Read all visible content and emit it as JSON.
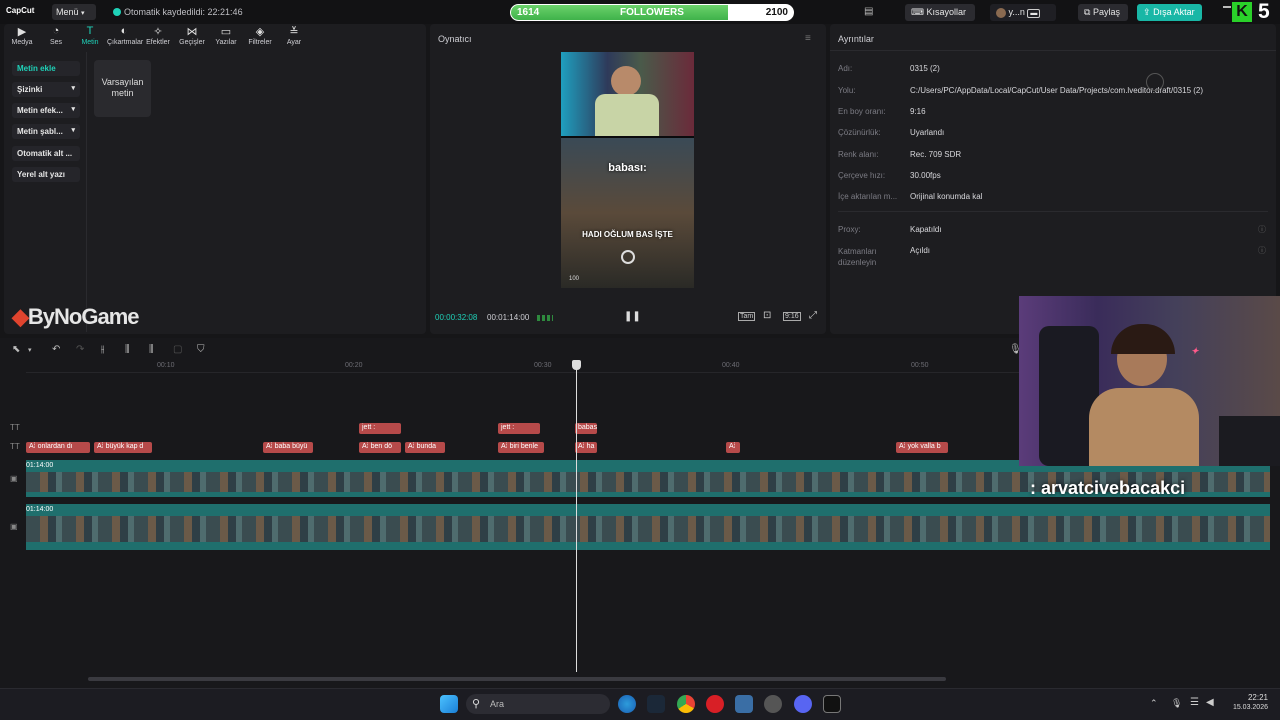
{
  "topbar": {
    "app_name": "CapCut",
    "menu_label": "Menü",
    "saved_text": "Otomatik kaydedildi: 22:21:46",
    "followers_current": "1614",
    "followers_label": "FOLLOWERS",
    "followers_goal": "2100",
    "followers_progress": 0.7686,
    "shortcuts_label": "Kısayollar",
    "user_label": "y...n",
    "share_label": "Paylaş",
    "export_label": "Dışa Aktar",
    "corner_number": "5"
  },
  "toolbar": {
    "items": [
      {
        "label": "Medya",
        "icon": "media-icon"
      },
      {
        "label": "Ses",
        "icon": "audio-icon"
      },
      {
        "label": "Metin",
        "icon": "text-icon"
      },
      {
        "label": "Çıkartmalar",
        "icon": "sticker-icon"
      },
      {
        "label": "Efektler",
        "icon": "effects-icon"
      },
      {
        "label": "Geçişler",
        "icon": "transitions-icon"
      },
      {
        "label": "Yazılar",
        "icon": "captions-icon"
      },
      {
        "label": "Filtreler",
        "icon": "filters-icon"
      },
      {
        "label": "Ayar",
        "icon": "adjust-icon"
      }
    ],
    "active": "Metin"
  },
  "sidebar": {
    "items": [
      "Metin ekle",
      "Şizinki",
      "Metin efek...",
      "Metin şabl...",
      "Otomatik alt ...",
      "Yerel alt yazı"
    ],
    "tile_label": "Varsayılan metin",
    "watermark": "ByNoGame"
  },
  "player": {
    "title": "Oynatıcı",
    "current_time": "00:00:32:08",
    "total_time": "00:01:14:00",
    "subtitle_1": "babası:",
    "subtitle_2": "HADI OĞLUM BAS İŞTE",
    "ratio_label": "9:16",
    "full_label": "Tam",
    "hud_value": "100"
  },
  "details": {
    "title": "Ayrıntılar",
    "rows": [
      {
        "label": "Adı:",
        "value": "0315 (2)"
      },
      {
        "label": "Yolu:",
        "value": "C:/Users/PC/AppData/Local/CapCut/User Data/Projects/com.lveditor.draft/0315 (2)"
      },
      {
        "label": "En boy oranı:",
        "value": "9:16"
      },
      {
        "label": "Çözünürlük:",
        "value": "Uyarlandı"
      },
      {
        "label": "Renk alanı:",
        "value": "Rec. 709 SDR"
      },
      {
        "label": "Çerçeve hızı:",
        "value": "30.00fps"
      },
      {
        "label": "İçe aktarılan m...",
        "value": "Orijinal konumda kal"
      },
      {
        "label": "Proxy:",
        "value": "Kapatıldı"
      },
      {
        "label": "Katmanları düzenleyin",
        "value": "Açıldı"
      }
    ]
  },
  "timeline": {
    "ticks": [
      "00:10",
      "00:20",
      "00:30",
      "00:40",
      "00:50"
    ],
    "track1_clips": [
      "jett :",
      "jett :",
      "babası"
    ],
    "track2_clips": [
      "onlardan dı",
      "büyük kap d",
      "baba büyü",
      "ben dö",
      "bunda",
      "biri benle",
      "ha",
      "",
      "yok valla b"
    ],
    "video_track_1_label": "01:14:00",
    "video_track_2_label": "01:14:00",
    "overlay_caption": ": arvatcivebacakci"
  },
  "taskbar": {
    "search_placeholder": "Ara",
    "time": "22:21",
    "date": "15.03.2026"
  }
}
